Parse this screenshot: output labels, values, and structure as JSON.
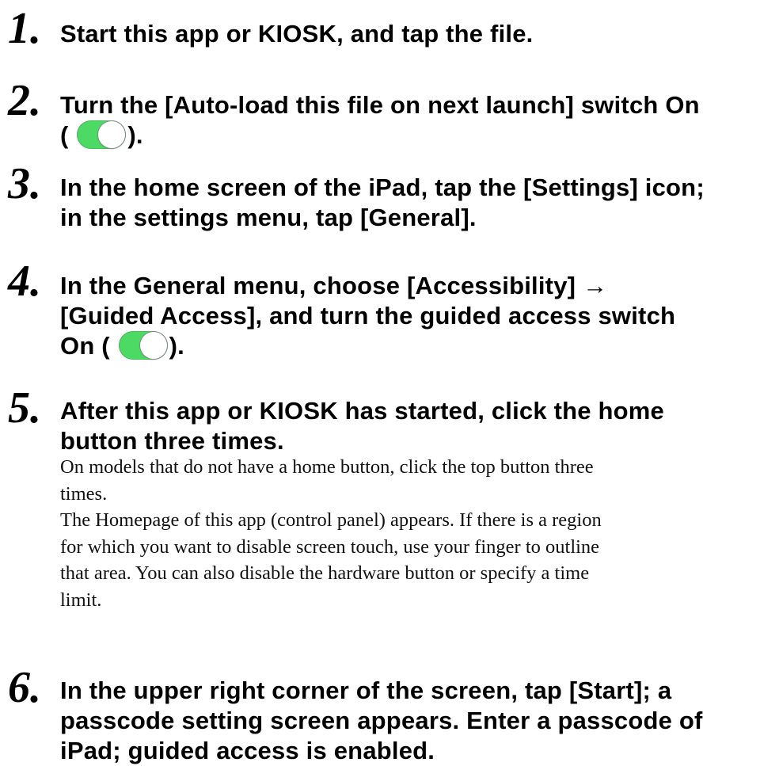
{
  "steps": [
    {
      "number": "1",
      "title_lines": [
        "Start this app or KIOSK, and tap the file."
      ]
    },
    {
      "number": "2",
      "title_lines": [
        "Turn the [Auto-load this file on next launch] switch On"
      ],
      "toggle_line": {
        "before": "(",
        "after": ")."
      },
      "toggle_state": "on"
    },
    {
      "number": "3",
      "title_lines": [
        "In the home screen of the iPad, tap the [Settings] icon;",
        "in the settings menu, tap [General]."
      ]
    },
    {
      "number": "4",
      "title_lines": [
        "In the General menu, choose [Accessibility] →",
        "[Guided Access], and turn the guided access switch"
      ],
      "toggle_line": {
        "before": "On (",
        "after": ")."
      },
      "toggle_state": "on"
    },
    {
      "number": "5",
      "title_lines": [
        "After this app or KIOSK has started, click the home",
        "button three times."
      ],
      "body_lines": [
        "On models that do not have a home button, click the top button three",
        "times.",
        "The Homepage of this app (control panel) appears. If there is a region",
        "for which you want to disable screen touch, use your finger to outline",
        "that area. You can also disable the hardware button or specify a time",
        "limit."
      ]
    },
    {
      "number": "6",
      "title_lines": [
        "In the upper right corner of the screen, tap [Start]; a",
        "passcode setting screen appears. Enter a passcode of",
        "iPad; guided access is enabled."
      ]
    }
  ],
  "colors": {
    "toggle_on": "#4cd964",
    "text": "#000000"
  }
}
